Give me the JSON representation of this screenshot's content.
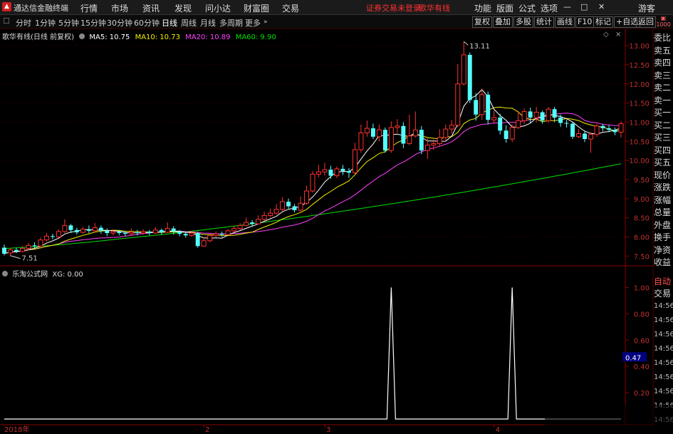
{
  "menubar": {
    "logo_icon": "tdx-logo-icon",
    "app_title": "通达信金融终端",
    "items": [
      "行情",
      "市场",
      "资讯",
      "发现",
      "问小达",
      "财富圈",
      "交易"
    ],
    "warning": "证券交易未登录",
    "stock_name": "歌华有线",
    "right_items": [
      "功能",
      "版面",
      "公式",
      "选项"
    ],
    "user": "游客",
    "window_buttons": [
      "—",
      "□",
      "✕"
    ]
  },
  "toolbar": {
    "periods": [
      "分时",
      "1分钟",
      "5分钟",
      "15分钟",
      "30分钟",
      "60分钟",
      "日线",
      "周线",
      "月线",
      "多周期",
      "更多"
    ],
    "active": "日线",
    "right_buttons": [
      "复权",
      "叠加",
      "多股",
      "统计",
      "画线",
      "F10",
      "标记",
      "+自选",
      "返回"
    ]
  },
  "legend": {
    "title": "歌华有线(日线 前复权)",
    "ma5": "MA5: 10.75",
    "ma10": "MA10: 10.73",
    "ma20": "MA20: 10.89",
    "ma60": "MA60: 9.90",
    "colors": {
      "ma5": "#ffffff",
      "ma10": "#f0f000",
      "ma20": "#ff40ff",
      "ma60": "#00e000"
    }
  },
  "sub_legend": {
    "title": "乐淘公式网",
    "xg": "XG: 0.00"
  },
  "right_panel": {
    "labels": [
      "委比",
      "卖五",
      "卖四",
      "卖三",
      "卖二",
      "卖一",
      "买一",
      "买二",
      "买三",
      "买四",
      "买五",
      "现价",
      "涨跌",
      "涨幅",
      "总量",
      "外盘",
      "换手",
      "净资",
      "收益"
    ],
    "sub_labels": [
      "自动",
      "交易"
    ],
    "times": [
      "14:56",
      "14:56",
      "14:56",
      "14:56",
      "14:56",
      "14:56",
      "14:56",
      "14:56",
      "14:56"
    ]
  },
  "chart_data": [
    {
      "type": "candlestick",
      "title": "歌华有线(日线 前复权)",
      "ylim": [
        7.3,
        13.3
      ],
      "y_ticks": [
        7.5,
        8.0,
        8.5,
        9.0,
        9.5,
        10.0,
        10.5,
        11.0,
        11.5,
        12.0,
        12.5,
        13.0
      ],
      "y_tick_labels": [
        "7.50",
        "8.00",
        "8.50",
        "9.00",
        "9.50",
        "10.00",
        "10.50",
        "11.00",
        "11.50",
        "12.00",
        "12.50",
        "13.00"
      ],
      "annotations": {
        "high_label": "13.11",
        "low_label": "7.51"
      },
      "x_labels": [
        "2018年",
        "2",
        "3",
        "4"
      ],
      "x_label_index": [
        0,
        33,
        53,
        81
      ],
      "candles": [
        [
          7.72,
          7.56,
          7.8,
          7.52
        ],
        [
          7.58,
          7.66,
          7.7,
          7.51
        ],
        [
          7.66,
          7.62,
          7.72,
          7.58
        ],
        [
          7.62,
          7.7,
          7.76,
          7.6
        ],
        [
          7.7,
          7.78,
          7.84,
          7.66
        ],
        [
          7.78,
          7.76,
          7.86,
          7.7
        ],
        [
          7.76,
          7.92,
          7.98,
          7.74
        ],
        [
          7.92,
          8.02,
          8.1,
          7.88
        ],
        [
          8.02,
          8.0,
          8.08,
          7.94
        ],
        [
          8.0,
          8.14,
          8.2,
          7.98
        ],
        [
          8.14,
          8.3,
          8.46,
          8.1
        ],
        [
          8.3,
          8.18,
          8.34,
          8.1
        ],
        [
          8.18,
          8.12,
          8.24,
          8.06
        ],
        [
          8.12,
          8.2,
          8.26,
          8.08
        ],
        [
          8.2,
          8.16,
          8.3,
          8.1
        ],
        [
          8.16,
          8.24,
          8.36,
          8.12
        ],
        [
          8.24,
          8.16,
          8.3,
          8.08
        ],
        [
          8.16,
          8.1,
          8.22,
          8.02
        ],
        [
          8.1,
          8.14,
          8.2,
          8.04
        ],
        [
          8.14,
          8.1,
          8.18,
          8.04
        ],
        [
          8.1,
          8.08,
          8.16,
          8.02
        ],
        [
          8.08,
          8.12,
          8.22,
          8.04
        ],
        [
          8.12,
          8.1,
          8.18,
          8.04
        ],
        [
          8.1,
          8.14,
          8.2,
          8.06
        ],
        [
          8.14,
          8.1,
          8.18,
          8.04
        ],
        [
          8.1,
          8.18,
          8.26,
          8.08
        ],
        [
          8.18,
          8.12,
          8.22,
          8.06
        ],
        [
          8.12,
          8.22,
          8.38,
          8.1
        ],
        [
          8.22,
          8.14,
          8.28,
          8.06
        ],
        [
          8.14,
          8.08,
          8.18,
          8.02
        ],
        [
          8.08,
          8.04,
          8.12,
          7.98
        ],
        [
          8.04,
          8.1,
          8.16,
          8.0
        ],
        [
          8.1,
          7.76,
          8.14,
          7.72
        ],
        [
          7.76,
          7.9,
          7.98,
          7.74
        ],
        [
          7.9,
          8.04,
          8.08,
          7.86
        ],
        [
          8.04,
          8.08,
          8.14,
          8.0
        ],
        [
          8.08,
          8.06,
          8.14,
          8.0
        ],
        [
          8.06,
          8.16,
          8.2,
          8.04
        ],
        [
          8.16,
          8.22,
          8.28,
          8.12
        ],
        [
          8.22,
          8.3,
          8.36,
          8.18
        ],
        [
          8.3,
          8.38,
          8.5,
          8.28
        ],
        [
          8.38,
          8.34,
          8.44,
          8.28
        ],
        [
          8.34,
          8.46,
          8.56,
          8.32
        ],
        [
          8.46,
          8.56,
          8.66,
          8.42
        ],
        [
          8.56,
          8.62,
          8.74,
          8.52
        ],
        [
          8.62,
          8.72,
          8.86,
          8.58
        ],
        [
          8.72,
          8.92,
          9.04,
          8.68
        ],
        [
          8.92,
          8.8,
          9.0,
          8.74
        ],
        [
          8.8,
          8.7,
          8.86,
          8.64
        ],
        [
          8.7,
          8.88,
          9.06,
          8.66
        ],
        [
          8.88,
          9.2,
          9.34,
          8.84
        ],
        [
          9.2,
          9.64,
          9.72,
          9.16
        ],
        [
          9.64,
          9.7,
          9.88,
          9.56
        ],
        [
          9.7,
          9.76,
          9.94,
          9.6
        ],
        [
          9.76,
          9.6,
          9.86,
          9.52
        ],
        [
          9.6,
          9.78,
          9.84,
          9.54
        ],
        [
          9.78,
          9.72,
          9.88,
          9.62
        ],
        [
          9.72,
          9.68,
          9.8,
          9.54
        ],
        [
          9.68,
          10.28,
          10.46,
          9.64
        ],
        [
          10.28,
          10.72,
          10.94,
          10.2
        ],
        [
          10.72,
          10.84,
          11.04,
          10.62
        ],
        [
          10.84,
          10.62,
          10.96,
          10.56
        ],
        [
          10.62,
          10.8,
          10.94,
          10.5
        ],
        [
          10.8,
          10.26,
          10.86,
          10.2
        ],
        [
          10.26,
          10.86,
          11.02,
          10.2
        ],
        [
          10.86,
          10.9,
          11.08,
          10.72
        ],
        [
          10.9,
          10.44,
          11.0,
          10.32
        ],
        [
          10.44,
          10.64,
          11.2,
          10.4
        ],
        [
          10.64,
          10.8,
          11.28,
          10.6
        ],
        [
          10.8,
          10.26,
          10.9,
          10.16
        ],
        [
          10.26,
          10.4,
          10.58,
          10.04
        ],
        [
          10.4,
          10.44,
          10.54,
          10.28
        ],
        [
          10.44,
          10.6,
          10.82,
          10.36
        ],
        [
          10.6,
          10.82,
          10.94,
          10.52
        ],
        [
          10.82,
          10.92,
          11.06,
          10.7
        ],
        [
          10.92,
          12.0,
          12.52,
          10.86
        ],
        [
          12.0,
          12.76,
          13.11,
          11.96
        ],
        [
          12.76,
          11.58,
          12.82,
          11.5
        ],
        [
          11.58,
          11.2,
          11.76,
          11.04
        ],
        [
          11.2,
          11.72,
          11.88,
          11.06
        ],
        [
          11.72,
          11.06,
          11.8,
          10.94
        ],
        [
          11.06,
          11.12,
          11.3,
          10.96
        ],
        [
          11.12,
          10.78,
          11.22,
          10.68
        ],
        [
          10.78,
          10.56,
          10.92,
          10.46
        ],
        [
          10.56,
          10.86,
          10.94,
          10.48
        ],
        [
          10.86,
          11.04,
          11.3,
          10.82
        ],
        [
          11.04,
          11.28,
          11.36,
          10.96
        ],
        [
          11.28,
          11.12,
          11.38,
          10.98
        ],
        [
          11.12,
          11.26,
          11.4,
          11.0
        ],
        [
          11.26,
          11.04,
          11.3,
          10.96
        ],
        [
          11.04,
          11.34,
          11.4,
          10.98
        ],
        [
          11.34,
          11.12,
          11.4,
          11.0
        ],
        [
          11.12,
          10.98,
          11.2,
          10.88
        ],
        [
          10.98,
          10.96,
          11.06,
          10.86
        ],
        [
          10.96,
          10.62,
          11.0,
          10.56
        ],
        [
          10.62,
          10.7,
          10.82,
          10.58
        ],
        [
          10.7,
          10.56,
          10.78,
          10.48
        ],
        [
          10.56,
          10.68,
          10.74,
          10.2
        ],
        [
          10.68,
          10.9,
          10.96,
          10.62
        ],
        [
          10.9,
          10.84,
          10.96,
          10.76
        ],
        [
          10.84,
          10.8,
          10.92,
          10.74
        ],
        [
          10.8,
          10.74,
          10.86,
          10.66
        ],
        [
          10.74,
          10.96,
          11.02,
          10.6
        ]
      ]
    },
    {
      "type": "line",
      "title": "乐淘公式网",
      "series": [
        {
          "name": "XG",
          "values_note": "spike",
          "spikes_at": [
            64,
            84
          ]
        }
      ],
      "ylim": [
        0,
        1.1
      ],
      "y_ticks": [
        0.2,
        0.4,
        0.6,
        0.8,
        1.0
      ],
      "y_tick_labels": [
        "0.20",
        "0.40",
        "0.60",
        "0.80",
        "1.00"
      ],
      "cursor_value": "0.47"
    }
  ]
}
